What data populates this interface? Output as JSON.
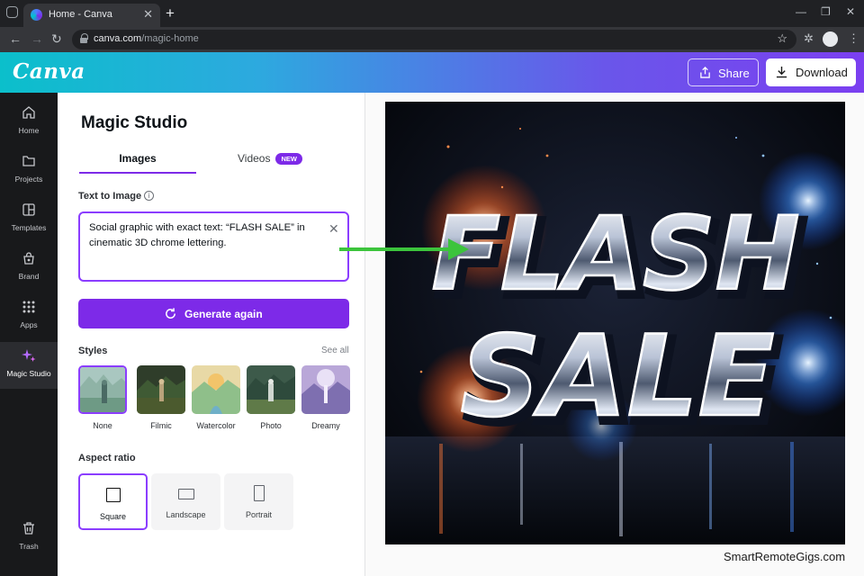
{
  "browser": {
    "tab_title": "Home - Canva",
    "tab_close": "✕",
    "new_tab": "+",
    "url_host": "canva.com",
    "url_path": "/magic-home"
  },
  "header": {
    "logo": "Canva",
    "share_label": "Share",
    "download_label": "Download"
  },
  "rail": {
    "items": [
      {
        "label": "Home",
        "icon": "home-icon"
      },
      {
        "label": "Projects",
        "icon": "folder-icon"
      },
      {
        "label": "Templates",
        "icon": "templates-icon"
      },
      {
        "label": "Brand",
        "icon": "brand-icon"
      },
      {
        "label": "Apps",
        "icon": "apps-icon"
      },
      {
        "label": "Magic Studio",
        "icon": "sparkle-icon",
        "active": true
      },
      {
        "label": "Trash",
        "icon": "trash-icon"
      }
    ]
  },
  "panel": {
    "title": "Magic Studio",
    "tabs": [
      {
        "label": "Images",
        "active": true
      },
      {
        "label": "Videos",
        "badge": "NEW"
      }
    ],
    "text_to_image_label": "Text to Image",
    "prompt_value": "Social graphic with exact text: “FLASH SALE” in cinematic 3D chrome lettering.",
    "generate_label": "Generate again",
    "styles_label": "Styles",
    "see_all_label": "See all",
    "styles": [
      {
        "label": "None",
        "selected": true
      },
      {
        "label": "Filmic"
      },
      {
        "label": "Watercolor"
      },
      {
        "label": "Photo"
      },
      {
        "label": "Dreamy"
      }
    ],
    "aspect_label": "Aspect ratio",
    "aspects": [
      {
        "label": "Square",
        "selected": true
      },
      {
        "label": "Landscape"
      },
      {
        "label": "Portrait"
      }
    ]
  },
  "canvas": {
    "artwork_line1": "FLASH",
    "artwork_line2": "SALE",
    "watermark": "SmartRemoteGigs.com"
  },
  "colors": {
    "accent": "#7d2ae8",
    "annotation_arrow": "#3cc43c"
  }
}
